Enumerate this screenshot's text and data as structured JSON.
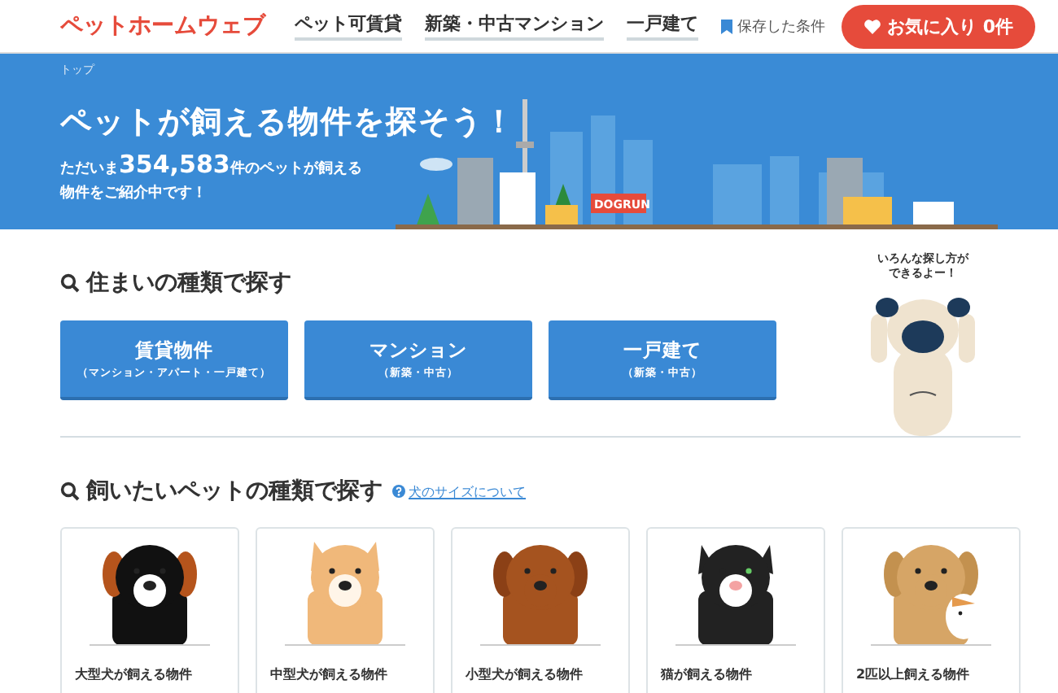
{
  "header": {
    "logo": "ペットホームウェブ",
    "nav": [
      {
        "label": "ペット可賃貸"
      },
      {
        "label": "新築・中古マンション"
      },
      {
        "label": "一戸建て"
      }
    ],
    "saved": "保存した条件",
    "favorites": "お気に入り 0件"
  },
  "breadcrumb": "トップ",
  "hero": {
    "title": "ペットが飼える物件を探そう！",
    "lead_before": "ただいま",
    "count": "354,583",
    "lead_after": "件のペットが飼える",
    "lead_line2": "物件をご紹介中です！",
    "sign": "DOGRUN"
  },
  "housing": {
    "heading": "住まいの種類で探す",
    "buttons": [
      {
        "label": "賃貸物件",
        "sub": "（マンション・アパート・一戸建て）"
      },
      {
        "label": "マンション",
        "sub": "（新築・中古）"
      },
      {
        "label": "一戸建て",
        "sub": "（新築・中古）"
      }
    ],
    "mascot_speech": [
      "いろんな探し方が",
      "できるよー！"
    ]
  },
  "pets": {
    "heading": "飼いたいペットの種類で探す",
    "help_link": "犬のサイズについて",
    "cards": [
      {
        "kind": "large-dog",
        "label": "大型犬が飼える物件"
      },
      {
        "kind": "medium-dog",
        "label": "中型犬が飼える物件"
      },
      {
        "kind": "small-dog",
        "label": "小型犬が飼える物件"
      },
      {
        "kind": "cat",
        "label": "猫が飼える物件"
      },
      {
        "kind": "multi",
        "label": "2匹以上飼える物件"
      }
    ]
  }
}
